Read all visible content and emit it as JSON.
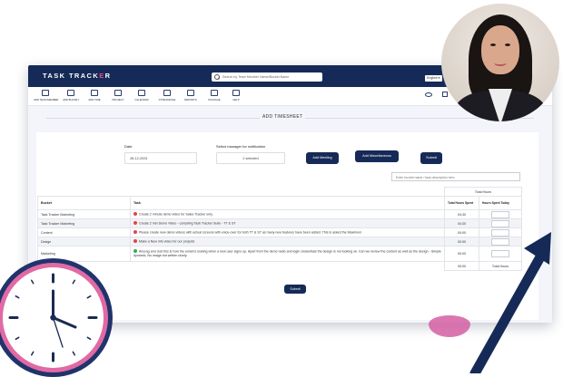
{
  "app": {
    "logo_main": "TASK TRACK",
    "logo_accent": "E",
    "logo_tail": "R",
    "search_placeholder": "Search by Team Member Name/Bucket Name",
    "language": "English ▾"
  },
  "toolbar": [
    {
      "label": "ADD TEAM MEMBER",
      "icon": "add-team-member-icon"
    },
    {
      "label": "ADD BUCKET",
      "icon": "add-bucket-icon"
    },
    {
      "label": "ADD TIME",
      "icon": "add-time-icon"
    },
    {
      "label": "PROJECT",
      "icon": "project-icon"
    },
    {
      "label": "CALENDAR",
      "icon": "calendar-icon"
    },
    {
      "label": "ATTENDANCE",
      "icon": "attendance-icon"
    },
    {
      "label": "REPORTS",
      "icon": "reports-icon"
    },
    {
      "label": "PACKAGE",
      "icon": "package-icon"
    },
    {
      "label": "HELP",
      "icon": "help-icon"
    }
  ],
  "page_title": "ADD TIMESHEET",
  "form": {
    "date_label": "Date",
    "date_value": "28-12-2024",
    "manager_label": "Select manager for notification",
    "manager_value": "2 selected",
    "add_meeting": "Add Meeting",
    "add_misc": "Add Miscellaneous",
    "submit": "Submit",
    "bucket_search_placeholder": "Enter bucket name / task description here"
  },
  "table": {
    "total_hours_label": "Total Hours",
    "headers": {
      "bucket": "Bucket",
      "task": "Task",
      "total_spent": "Total Hours Spent",
      "spent_today": "Hours Spent Today"
    },
    "rows": [
      {
        "bucket": "Task Tracker Marketing",
        "status": "red",
        "task": "Create 2 minute demo video for Sales Tracker only.",
        "spent": "04:30"
      },
      {
        "bucket": "Task Tracker Marketing",
        "status": "red",
        "task": "Create 2 min Demo Video - compiling Task Tracker Suite - TT & ST",
        "spent": "04:30"
      },
      {
        "bucket": "Content",
        "status": "red",
        "task": "Please create new demo videos with actual screens with voice-over for both TT & ST as many new features have been added. This is asked the Maximum",
        "spent": "00:00"
      },
      {
        "bucket": "Design",
        "status": "red",
        "task": "Make a New info video for our projects",
        "spent": "00:00"
      },
      {
        "bucket": "Marketing",
        "status": "green",
        "task": "Anurag and Just this is how the email is looking when a new user signs up. Apart from the demo radio and login credentials the design is not looking ok. Can we review the content as well as the design - Simple dynamic, No image but written nicely.",
        "spent": "00:00"
      }
    ],
    "footer_total": "00:00",
    "footer_label": "Total Hours"
  },
  "bottom_submit": "Submit",
  "colors": {
    "navy": "#152a57",
    "accent_pink": "#e84e8a",
    "status_red": "#e34545",
    "status_green": "#2bb24c"
  }
}
